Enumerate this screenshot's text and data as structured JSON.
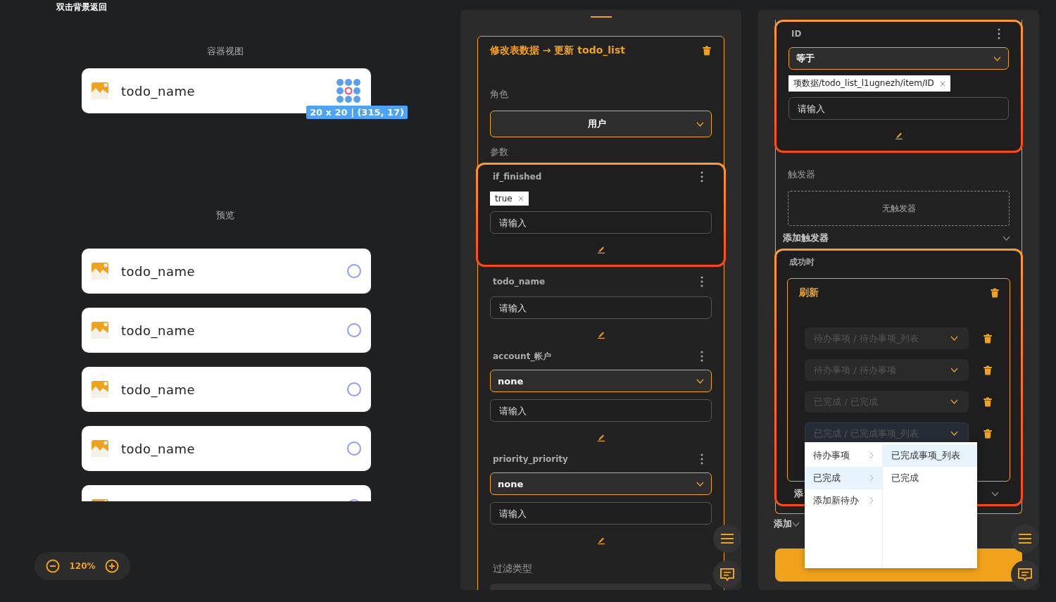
{
  "hint": "双击背景返回",
  "container_view": {
    "title": "容器视图",
    "item": {
      "label": "todo_name"
    },
    "size_tooltip": "20 x 20 | (315, 17)"
  },
  "preview": {
    "title": "预览",
    "items": [
      {
        "kind": "full",
        "label": "todo_name",
        "checked": false
      },
      {
        "kind": "full",
        "label": "todo_name",
        "checked": false
      },
      {
        "kind": "full",
        "label": "todo_name",
        "checked": false
      },
      {
        "kind": "full",
        "label": "todo_name",
        "checked": false
      },
      {
        "kind": "clipped",
        "checked": false
      }
    ]
  },
  "zoom": {
    "value": "120%"
  },
  "action_panel": {
    "title": "修改表数据 → 更新 todo_list",
    "role_label": "角色",
    "role_value": "用户",
    "params_label": "参数",
    "params": [
      {
        "name": "if_finished",
        "highlighted": true,
        "tags": [
          "true"
        ],
        "placeholder": "请输入"
      },
      {
        "name": "todo_name",
        "highlighted": false,
        "placeholder": "请输入"
      },
      {
        "name": "account_帐户",
        "highlighted": false,
        "select": "none",
        "placeholder": "请输入"
      },
      {
        "name": "priority_priority",
        "highlighted": false,
        "select": "none",
        "placeholder": "请输入"
      }
    ],
    "filter_label": "过滤类型"
  },
  "right_panel": {
    "id_param": {
      "name": "ID",
      "highlighted": true,
      "select": "等于",
      "tags": [
        "项数据/todo_list_l1ugnezh/item/ID"
      ],
      "placeholder": "请输入"
    },
    "triggers": {
      "title": "触发器",
      "empty": "无触发器",
      "add": "添加触发器"
    },
    "on_success": {
      "title": "成功时",
      "highlighted": true,
      "action_title": "刷新",
      "targets": [
        {
          "value": "待办事项 / 待办事项_列表",
          "focused": false
        },
        {
          "value": "待办事项 / 待办事项",
          "focused": false
        },
        {
          "value": "已完成 / 已完成",
          "focused": false
        },
        {
          "value": "已完成 / 已完成事项_列表",
          "focused": true
        }
      ],
      "add_partial": "添"
    },
    "add_partial": "添加",
    "cascader": {
      "columns": [
        {
          "options": [
            {
              "label": "待办事项",
              "selected": false,
              "has_children": true
            },
            {
              "label": "已完成",
              "selected": true,
              "has_children": true
            },
            {
              "label": "添加新待办",
              "selected": false,
              "has_children": true
            }
          ]
        },
        {
          "options": [
            {
              "label": "已完成事项_列表",
              "selected": true,
              "has_children": false
            },
            {
              "label": "已完成",
              "selected": false,
              "has_children": false
            }
          ]
        }
      ]
    }
  }
}
